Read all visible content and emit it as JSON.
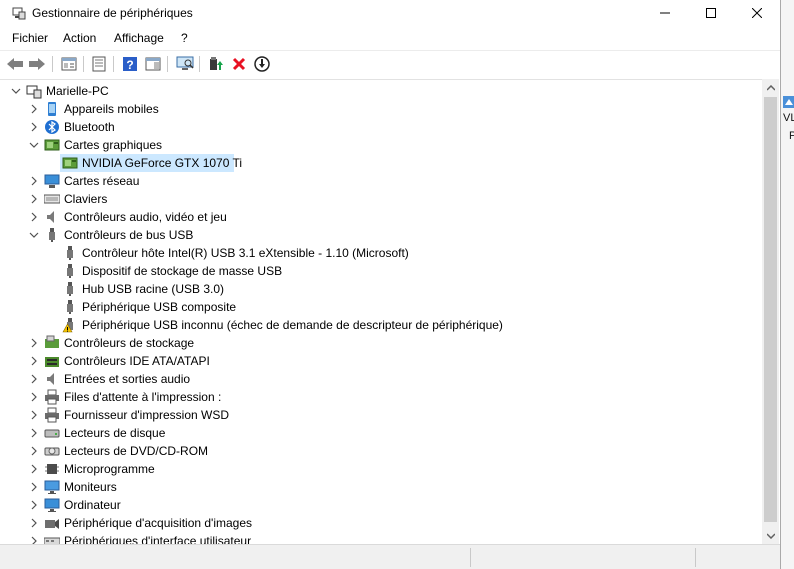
{
  "window": {
    "title": "Gestionnaire de périphériques",
    "minimize_glyph": "—",
    "maximize_glyph": "☐",
    "close_glyph": "✕"
  },
  "menu": {
    "file": "Fichier",
    "action": "Action",
    "view": "Affichage",
    "help": "?"
  },
  "toolbar": {
    "buttons": [
      "back-icon",
      "forward-icon",
      "properties-icon",
      "show-hidden-icon",
      "help-icon",
      "action-pane-icon",
      "scan-hardware-icon",
      "update-driver-icon",
      "uninstall-icon",
      "disable-icon"
    ]
  },
  "tree": {
    "root": "Marielle-PC",
    "items": [
      {
        "label": "Appareils mobiles",
        "icon": "mobile-device-icon",
        "expanded": false
      },
      {
        "label": "Bluetooth",
        "icon": "bluetooth-icon",
        "expanded": false
      },
      {
        "label": "Cartes graphiques",
        "icon": "display-adapter-icon",
        "expanded": true,
        "children": [
          {
            "label": "NVIDIA GeForce GTX 1070 Ti",
            "icon": "display-adapter-icon",
            "selected": true
          }
        ]
      },
      {
        "label": "Cartes réseau",
        "icon": "network-adapter-icon",
        "expanded": false
      },
      {
        "label": "Claviers",
        "icon": "keyboard-icon",
        "expanded": false
      },
      {
        "label": "Contrôleurs audio, vidéo et jeu",
        "icon": "speaker-icon",
        "expanded": false
      },
      {
        "label": "Contrôleurs de bus USB",
        "icon": "usb-icon",
        "expanded": true,
        "children": [
          {
            "label": "Contrôleur hôte Intel(R) USB 3.1 eXtensible - 1.10 (Microsoft)",
            "icon": "usb-icon"
          },
          {
            "label": "Dispositif de stockage de masse USB",
            "icon": "usb-icon"
          },
          {
            "label": "Hub USB racine (USB 3.0)",
            "icon": "usb-icon"
          },
          {
            "label": "Périphérique USB composite",
            "icon": "usb-icon"
          },
          {
            "label": "Périphérique USB inconnu (échec de demande de descripteur de périphérique)",
            "icon": "usb-warning-icon"
          }
        ]
      },
      {
        "label": "Contrôleurs de stockage",
        "icon": "storage-controller-icon",
        "expanded": false
      },
      {
        "label": "Contrôleurs IDE ATA/ATAPI",
        "icon": "ide-controller-icon",
        "expanded": false
      },
      {
        "label": "Entrées et sorties audio",
        "icon": "speaker-icon",
        "expanded": false
      },
      {
        "label": "Files d'attente à l'impression :",
        "icon": "printer-icon",
        "expanded": false
      },
      {
        "label": "Fournisseur d'impression WSD",
        "icon": "printer-icon",
        "expanded": false
      },
      {
        "label": "Lecteurs de disque",
        "icon": "disk-drive-icon",
        "expanded": false
      },
      {
        "label": "Lecteurs de DVD/CD-ROM",
        "icon": "dvd-icon",
        "expanded": false
      },
      {
        "label": "Microprogramme",
        "icon": "firmware-icon",
        "expanded": false
      },
      {
        "label": "Moniteurs",
        "icon": "monitor-icon",
        "expanded": false
      },
      {
        "label": "Ordinateur",
        "icon": "computer-icon",
        "expanded": false
      },
      {
        "label": "Périphérique d'acquisition d'images",
        "icon": "camera-icon",
        "expanded": false
      },
      {
        "label": "Périphériques d'interface utilisateur",
        "icon": "hid-icon",
        "expanded": false
      }
    ]
  },
  "desktop": {
    "partial_text_1": "VLC",
    "partial_text_2": "P"
  },
  "colors": {
    "selection": "#cce8ff",
    "accent_blue": "#2b78d0",
    "warning_yellow": "#f5c400",
    "error_red": "#e81123"
  }
}
